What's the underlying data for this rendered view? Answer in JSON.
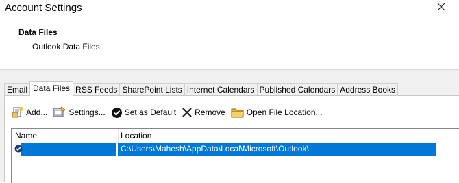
{
  "window": {
    "title": "Account Settings",
    "close_icon": "close-icon"
  },
  "header": {
    "title": "Data Files",
    "subtitle": "Outlook Data Files"
  },
  "tabs": [
    {
      "label": "Email",
      "active": false
    },
    {
      "label": "Data Files",
      "active": true
    },
    {
      "label": "RSS Feeds",
      "active": false
    },
    {
      "label": "SharePoint Lists",
      "active": false
    },
    {
      "label": "Internet Calendars",
      "active": false
    },
    {
      "label": "Published Calendars",
      "active": false
    },
    {
      "label": "Address Books",
      "active": false
    }
  ],
  "toolbar": {
    "add_label": "Add...",
    "settings_label": "Settings...",
    "default_label": "Set as Default",
    "remove_label": "Remove",
    "open_label": "Open File Location..."
  },
  "list": {
    "columns": {
      "name": "Name",
      "location": "Location"
    },
    "rows": [
      {
        "name_ellipsis": "...",
        "location": "C:\\Users\\Mahesh\\AppData\\Local\\Microsoft\\Outlook\\",
        "selected": true,
        "default": true
      }
    ]
  },
  "colors": {
    "selection": "#0078d7",
    "panel": "#f0f0f0"
  }
}
